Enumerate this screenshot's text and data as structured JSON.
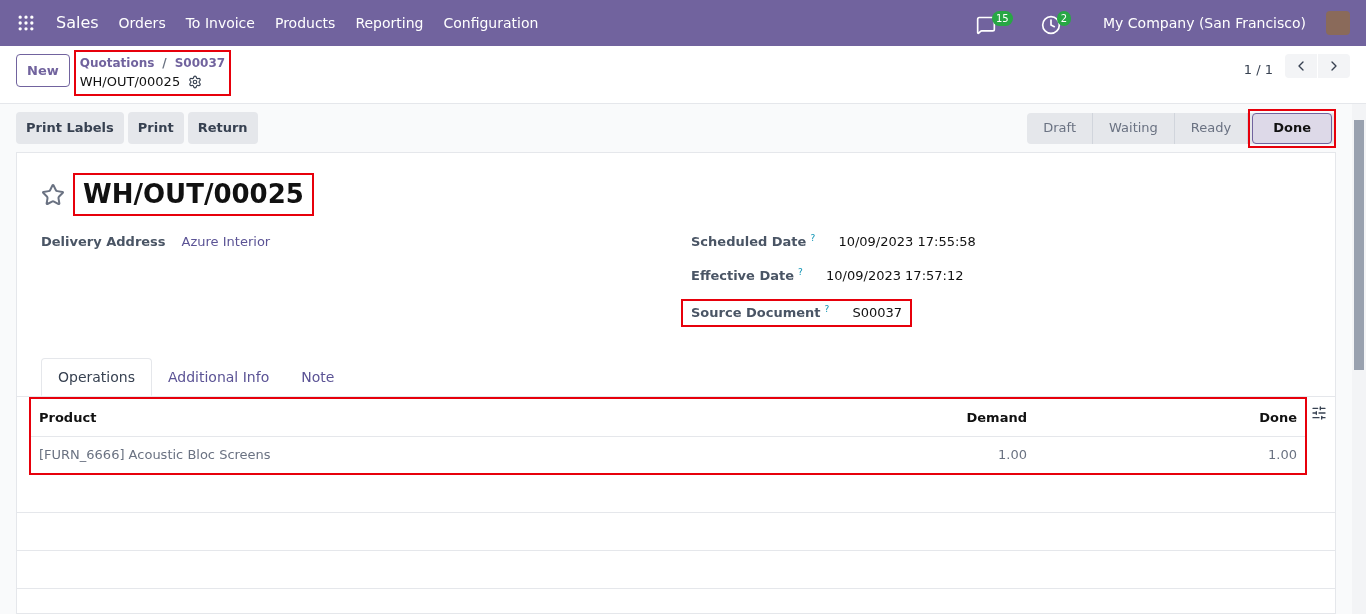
{
  "navbar": {
    "app": "Sales",
    "menu": [
      "Orders",
      "To Invoice",
      "Products",
      "Reporting",
      "Configuration"
    ],
    "messages_count": "15",
    "activities_count": "2",
    "company": "My Company (San Francisco)"
  },
  "control_panel": {
    "new_button": "New",
    "breadcrumb": {
      "parent": "Quotations",
      "separator": "/",
      "current": "S00037"
    },
    "record": "WH/OUT/00025",
    "pager": "1 / 1"
  },
  "actions": [
    "Print Labels",
    "Print",
    "Return"
  ],
  "statusbar": [
    {
      "label": "Draft",
      "selected": false
    },
    {
      "label": "Waiting",
      "selected": false
    },
    {
      "label": "Ready",
      "selected": false
    },
    {
      "label": "Done",
      "selected": true
    }
  ],
  "form": {
    "title": "WH/OUT/00025",
    "favorite": false,
    "left_fields": [
      {
        "label": "Delivery Address",
        "value": "Azure Interior",
        "link": true
      }
    ],
    "right_fields": [
      {
        "label": "Scheduled Date",
        "help": "?",
        "value": "10/09/2023 17:55:58",
        "highlight": false
      },
      {
        "label": "Effective Date",
        "help": "?",
        "value": "10/09/2023 17:57:12",
        "highlight": false
      },
      {
        "label": "Source Document",
        "help": "?",
        "value": "S00037",
        "highlight": true
      }
    ],
    "tabs": [
      {
        "label": "Operations",
        "selected": true
      },
      {
        "label": "Additional Info",
        "selected": false
      },
      {
        "label": "Note",
        "selected": false
      }
    ],
    "table": {
      "columns": [
        "Product",
        "Demand",
        "Done"
      ],
      "rows": [
        [
          "[FURN_6666] Acoustic Bloc Screens",
          "1.00",
          "1.00"
        ]
      ]
    }
  }
}
